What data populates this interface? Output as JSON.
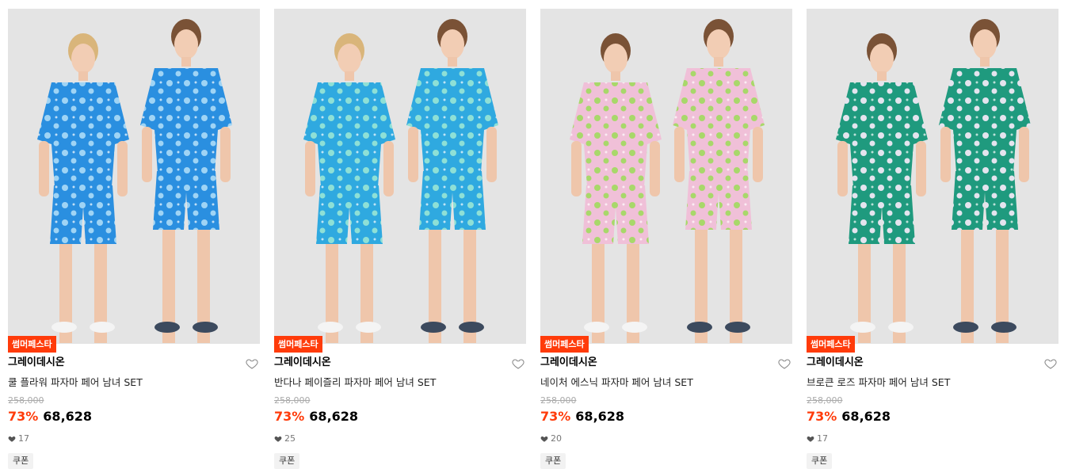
{
  "products": [
    {
      "badge": "썸머페스타",
      "brand": "그레이데시온",
      "title": "쿨 플라워 파자마 페어 남녀 SET",
      "original_price": "258,000",
      "discount": "73%",
      "price": "68,628",
      "likes": "17",
      "coupon": "쿠폰",
      "pattern_colors": [
        "#2a8fe0",
        "#9fd4f5"
      ]
    },
    {
      "badge": "썸머페스타",
      "brand": "그레이데시온",
      "title": "반다나 페이즐리 파자마 페어 남녀 SET",
      "original_price": "258,000",
      "discount": "73%",
      "price": "68,628",
      "likes": "25",
      "coupon": "쿠폰",
      "pattern_colors": [
        "#2fa9e0",
        "#8ee0d6"
      ]
    },
    {
      "badge": "썸머페스타",
      "brand": "그레이데시온",
      "title": "네이처 에스닉 파자마 페어 남녀 SET",
      "original_price": "258,000",
      "discount": "73%",
      "price": "68,628",
      "likes": "20",
      "coupon": "쿠폰",
      "pattern_colors": [
        "#f0c0d8",
        "#a8d86a"
      ]
    },
    {
      "badge": "썸머페스타",
      "brand": "그레이데시온",
      "title": "브로큰 로즈 파자마 페어 남녀 SET",
      "original_price": "258,000",
      "discount": "73%",
      "price": "68,628",
      "likes": "17",
      "coupon": "쿠폰",
      "pattern_colors": [
        "#1f9a7e",
        "#e4e4ee"
      ]
    }
  ],
  "colors": {
    "accent": "#ff3b0a",
    "background": "#ffffff",
    "thumb_bg": "#e3e3e3"
  },
  "icons": {
    "wish": "heart-outline-icon",
    "likes": "heart-filled-icon"
  }
}
